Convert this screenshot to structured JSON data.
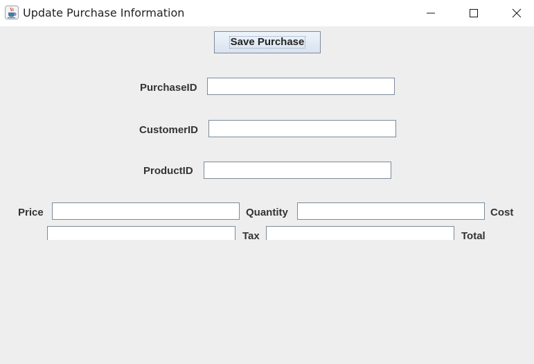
{
  "window": {
    "title": "Update Purchase Information",
    "app_icon": "java-cup-icon",
    "controls": [
      "minimize-icon",
      "maximize-icon",
      "close-icon"
    ]
  },
  "toolbar": {
    "save_label": "Save Purchase"
  },
  "form": {
    "purchase_id_label": "PurchaseID",
    "purchase_id_value": "",
    "customer_id_label": "CustomerID",
    "customer_id_value": "",
    "product_id_label": "ProductID",
    "product_id_value": "",
    "price_label": "Price",
    "price_value": "",
    "quantity_label": "Quantity",
    "quantity_value": "",
    "cost_label": "Cost",
    "cost_value": "",
    "tax_label": "Tax",
    "tax_value": "",
    "total_label": "Total"
  }
}
